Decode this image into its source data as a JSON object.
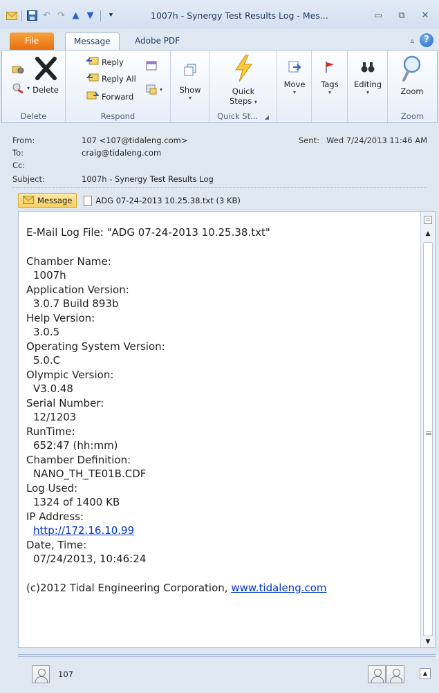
{
  "window": {
    "title": "1007h - Synergy Test Results Log - Mes...",
    "buttons": [
      "minimize",
      "restore",
      "close"
    ]
  },
  "ribbon": {
    "tabs": [
      "File",
      "Message",
      "Adobe PDF"
    ],
    "groups": {
      "delete": {
        "label": "Delete",
        "delete_button": "Delete"
      },
      "respond": {
        "label": "Respond",
        "reply": "Reply",
        "reply_all": "Reply All",
        "forward": "Forward"
      },
      "show": {
        "label": "Show"
      },
      "quick_steps": {
        "label": "Quick St...",
        "button": "Quick",
        "button2": "Steps"
      },
      "move": {
        "label": "Move"
      },
      "tags": {
        "label": "Tags"
      },
      "editing": {
        "label": "Editing"
      },
      "zoom": {
        "label": "Zoom",
        "button": "Zoom"
      }
    },
    "help": "?"
  },
  "header": {
    "from_label": "From:",
    "from": "107 <107@tidaleng.com>",
    "sent_label": "Sent:",
    "sent": "Wed 7/24/2013 11:46 AM",
    "to_label": "To:",
    "to": "craig@tidaleng.com",
    "cc_label": "Cc:",
    "cc": "",
    "subject_label": "Subject:",
    "subject": "1007h - Synergy Test Results Log"
  },
  "attachments": {
    "message_tab": "Message",
    "file": "ADG 07-24-2013 10.25.38.txt (3 KB)"
  },
  "body": {
    "intro": "E-Mail Log File: \"ADG 07-24-2013 10.25.38.txt\"",
    "fields": [
      {
        "label": "Chamber Name:",
        "value": "1007h"
      },
      {
        "label": "Application Version:",
        "value": "3.0.7 Build 893b"
      },
      {
        "label": "Help Version:",
        "value": "3.0.5"
      },
      {
        "label": "Operating System Version:",
        "value": "5.0.C"
      },
      {
        "label": "Olympic Version:",
        "value": "V3.0.48"
      },
      {
        "label": "Serial Number:",
        "value": "12/1203"
      },
      {
        "label": "RunTime:",
        "value": "652:47 (hh:mm)"
      },
      {
        "label": "Chamber Definition:",
        "value": "NANO_TH_TE01B.CDF"
      },
      {
        "label": "Log Used:",
        "value": "1324 of 1400 KB"
      },
      {
        "label": "IP Address:",
        "value": "http://172.16.10.99"
      },
      {
        "label": "Date, Time:",
        "value": "07/24/2013, 10:46:24"
      }
    ],
    "footer_prefix": "(c)2012 Tidal Engineering Corporation, ",
    "footer_link": "www.tidaleng.com"
  },
  "people_pane": {
    "name": "107"
  },
  "colors": {
    "file_tab": "#e86e12",
    "link": "#0033cc",
    "chrome": "#dfe7f1"
  }
}
